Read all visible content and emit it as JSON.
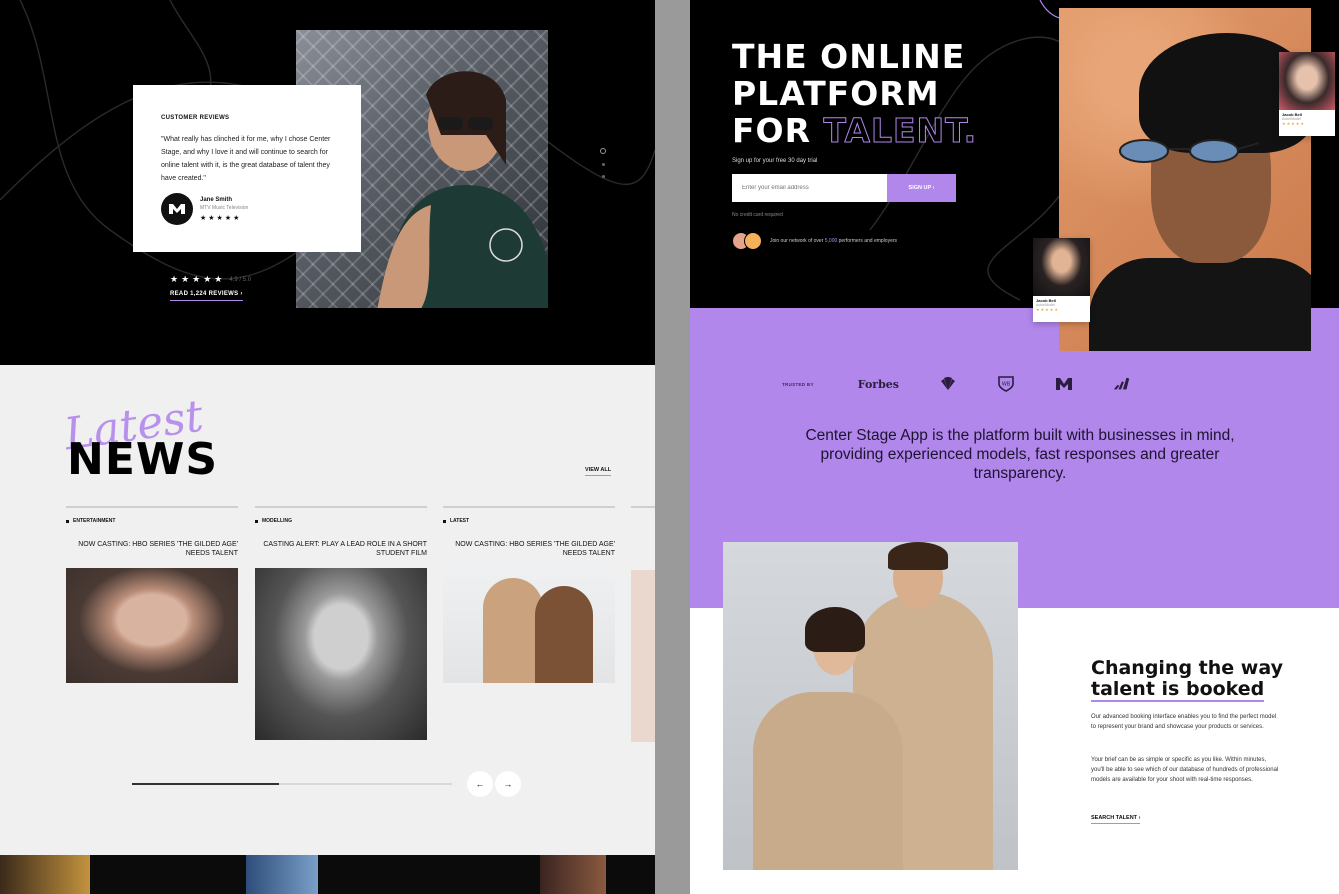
{
  "left": {
    "review": {
      "kicker": "CUSTOMER REVIEWS",
      "quote": "\"What really has clinched it for me, why I chose Center Stage, and why I love it and will continue to search for online talent with it, is the great database of talent they have created.\"",
      "author_name": "Jane Smith",
      "author_role": "MTV Music Television",
      "author_stars": "★★★★★"
    },
    "hero_rating": {
      "stars": "★★★★★",
      "score": "4.9 / 5.0"
    },
    "read_reviews": "READ 1,224 REVIEWS  ›",
    "news_script": "Latest",
    "news_title": "NEWS",
    "view_all": "VIEW ALL",
    "news": [
      {
        "category": "ENTERTAINMENT",
        "headline": "NOW CASTING: HBO SERIES 'THE GILDED AGE' NEEDS TALENT"
      },
      {
        "category": "MODELLING",
        "headline": "CASTING ALERT: PLAY A LEAD ROLE IN A SHORT STUDENT FILM"
      },
      {
        "category": "LATEST",
        "headline": "NOW CASTING: HBO SERIES 'THE GILDED AGE' NEEDS TALENT"
      }
    ],
    "slider_progress": 0.46,
    "prev_arrow": "←",
    "next_arrow": "→"
  },
  "right": {
    "hero": {
      "line1": "THE ONLINE",
      "line2": "PLATFORM",
      "line3_a": "FOR ",
      "line3_b": "TALENT.",
      "subtitle": "Sign up for your free 30 day trial",
      "email_placeholder": "Enter your email address",
      "signup_label": "SIGN UP  ›",
      "no_card": "No credit card required",
      "network_prefix": "Join our network of over ",
      "network_count": "5,000",
      "network_suffix": " performers and employers"
    },
    "mini_cards": [
      {
        "name": "Jacob Bell",
        "subtitle": "Actor/Model",
        "stars": "★★★★★"
      },
      {
        "name": "Jacob Bell",
        "subtitle": "Actor/Model",
        "stars": "★★★★★"
      }
    ],
    "trusted": {
      "label": "TRUSTED BY",
      "forbes": "Forbes",
      "logos": [
        "nbc-logo",
        "warner-bros-logo",
        "mtv-logo",
        "adidas-logo"
      ]
    },
    "purple_text": "Center Stage App is the platform built with businesses in mind, providing experienced models, fast responses and greater transparency.",
    "change": {
      "title_line1": "Changing the way",
      "title_line2": "talent is booked",
      "p1": "Our advanced booking interface enables you to find the perfect model to represent your brand and showcase your products or services.",
      "p2": "Your brief can be as simple or specific as you like. Within minutes, you'll be able to see which of our database of hundreds of professional models are available for your shoot with real-time responses.",
      "link": "SEARCH TALENT  ›"
    }
  },
  "colors": {
    "accent": "#b187ec",
    "dark": "#000000",
    "light": "#f0f0f0"
  }
}
